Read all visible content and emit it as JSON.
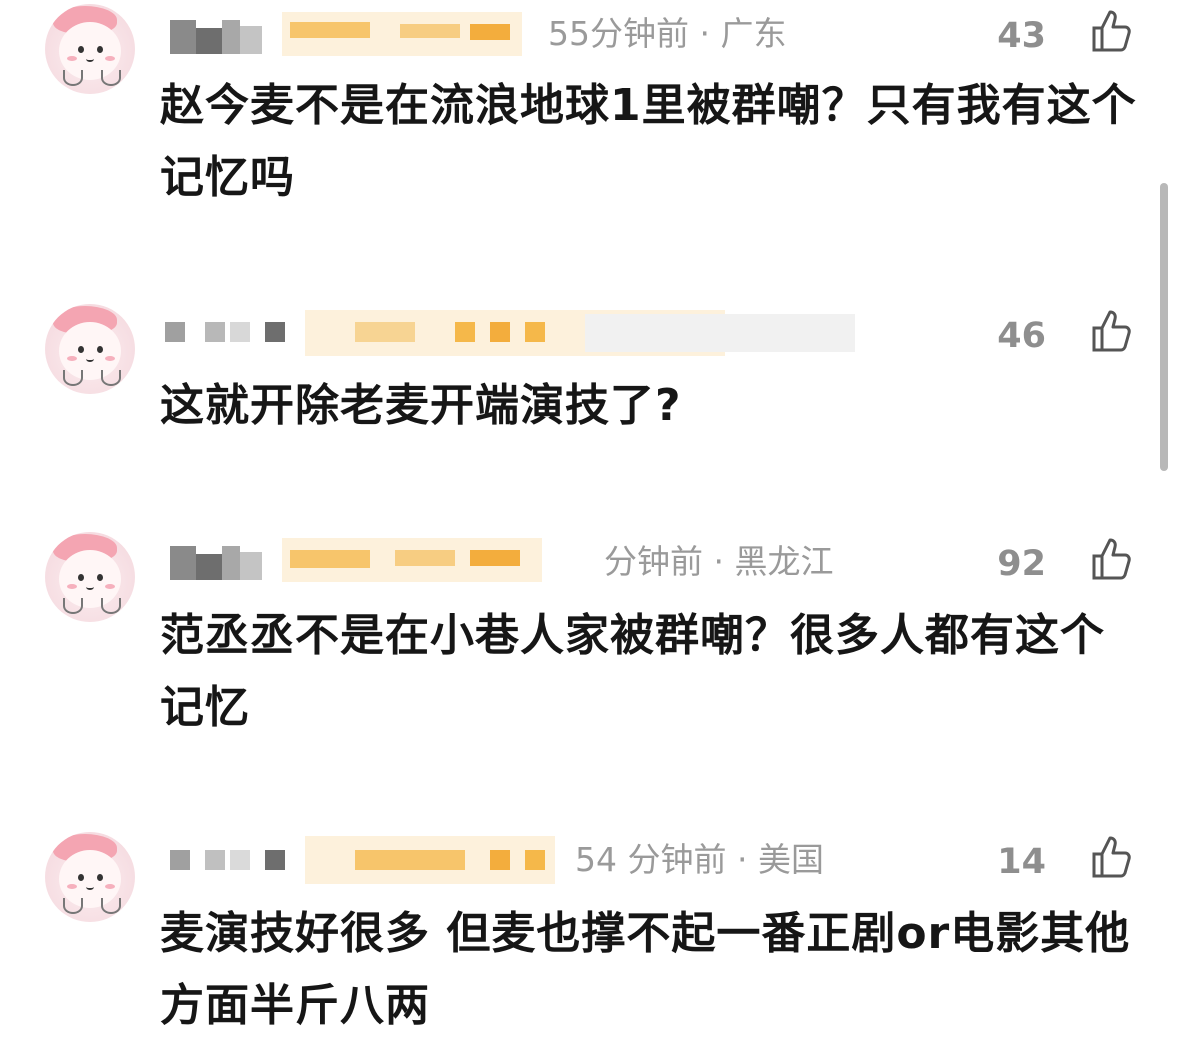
{
  "comments": [
    {
      "meta": "55分钟前 · 广东",
      "likes": "43",
      "text": "赵今麦不是在流浪地球1里被群嘲？只有我有这个记忆吗"
    },
    {
      "meta": "",
      "likes": "46",
      "text": "这就开除老麦开端演技了?"
    },
    {
      "meta": "分钟前 · 黑龙江",
      "likes": "92",
      "text": "范丞丞不是在小巷人家被群嘲？很多人都有这个记忆"
    },
    {
      "meta": "54 分钟前 · 美国",
      "likes": "14",
      "text": "麦演技好很多 但麦也撑不起一番正剧or电影其他方面半斤八两"
    }
  ],
  "icons": {
    "like": "thumbs-up-icon",
    "avatar": "avatar-icon"
  },
  "colors": {
    "text": "#161616",
    "meta": "#9a9a9a",
    "likes": "#8e8e8e",
    "mosaic_gray": "#8a8a8a",
    "mosaic_orange": "#f5b84a"
  }
}
